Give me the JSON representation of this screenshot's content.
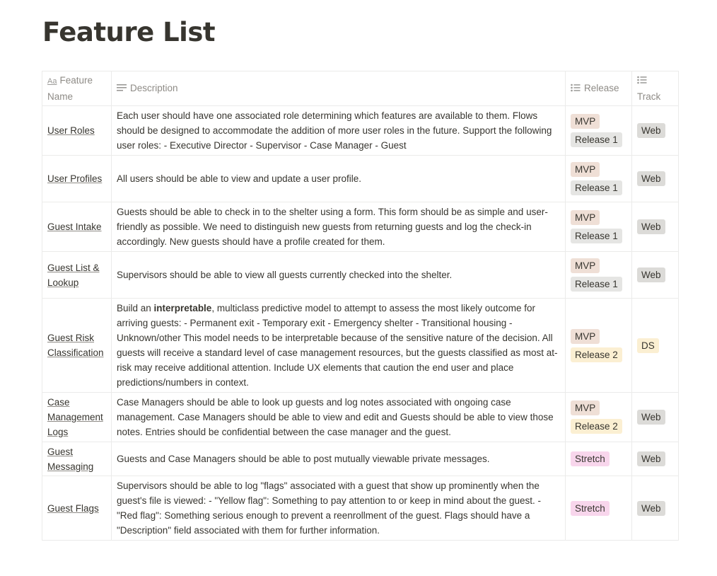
{
  "page": {
    "title": "Feature List"
  },
  "table": {
    "headers": {
      "name_icon": "Aa",
      "name": "Feature Name",
      "description": "Description",
      "release": "Release",
      "track": "Track"
    },
    "rows": [
      {
        "name": "User Roles",
        "desc_pre": "Each user should have one associated role determining which features are available to them. Flows should be designed to accommodate the addition of more user roles in the future. Support the following user roles: - Executive Director - Supervisor - Case Manager - Guest",
        "desc_bold": "",
        "desc_post": "",
        "release": [
          "MVP",
          "Release 1"
        ],
        "track": "Web"
      },
      {
        "name": "User Profiles",
        "desc_pre": "All users should be able to view and update a user profile.",
        "desc_bold": "",
        "desc_post": "",
        "release": [
          "MVP",
          "Release 1"
        ],
        "track": "Web"
      },
      {
        "name": "Guest Intake",
        "desc_pre": "Guests should be able to check in to the shelter using a form. This form should be as simple and user-friendly as possible. We need to distinguish new guests from returning guests and log the check-in accordingly. New guests should have a profile created for them.",
        "desc_bold": "",
        "desc_post": "",
        "release": [
          "MVP",
          "Release 1"
        ],
        "track": "Web"
      },
      {
        "name": "Guest List & Lookup",
        "desc_pre": "Supervisors should be able to view all guests currently checked into the shelter.",
        "desc_bold": "",
        "desc_post": "",
        "release": [
          "MVP",
          "Release 1"
        ],
        "track": "Web"
      },
      {
        "name": "Guest Risk Classification",
        "desc_pre": "Build an ",
        "desc_bold": "interpretable",
        "desc_post": ", multiclass predictive model to attempt to assess the most likely outcome for arriving guests: - Permanent exit - Temporary exit - Emergency shelter - Transitional housing - Unknown/other This model needs to be interpretable because of the sensitive nature of the decision. All guests will receive a standard level of case management resources, but the guests classified as most at-risk may receive additional attention. Include UX elements that caution the end user and place predictions/numbers in context.",
        "release": [
          "MVP",
          "Release 2"
        ],
        "track": "DS"
      },
      {
        "name": "Case Management Logs",
        "desc_pre": "Case Managers should be able to look up guests and log notes associated with ongoing case management. Case Managers should be able to view and edit and Guests should be able to view those notes. Entries should be confidential between the case manager and the guest.",
        "desc_bold": "",
        "desc_post": "",
        "release": [
          "MVP",
          "Release 2"
        ],
        "track": "Web"
      },
      {
        "name": "Guest Messaging",
        "desc_pre": "Guests and Case Managers should be able to post mutually viewable private messages.",
        "desc_bold": "",
        "desc_post": "",
        "release": [
          "Stretch"
        ],
        "track": "Web"
      },
      {
        "name": "Guest Flags",
        "desc_pre": "Supervisors should be able to log \"flags\" associated with a guest that show up prominently when the guest's file is viewed: - \"Yellow flag\": Something to pay attention to or keep in mind about the guest. - \"Red flag\": Something serious enough to prevent a reenrollment of the guest. Flags should have a \"Description\" field associated with them for further information.",
        "desc_bold": "",
        "desc_post": "",
        "release": [
          "Stretch"
        ],
        "track": "Web"
      }
    ]
  },
  "tag_colors": {
    "MVP": "#efdfd6",
    "Release 1": "#e5e5e3",
    "Release 2": "#fbefd2",
    "Stretch": "#f8d6ec",
    "Web": "#dcdbd8",
    "DS": "#fbefd2"
  }
}
